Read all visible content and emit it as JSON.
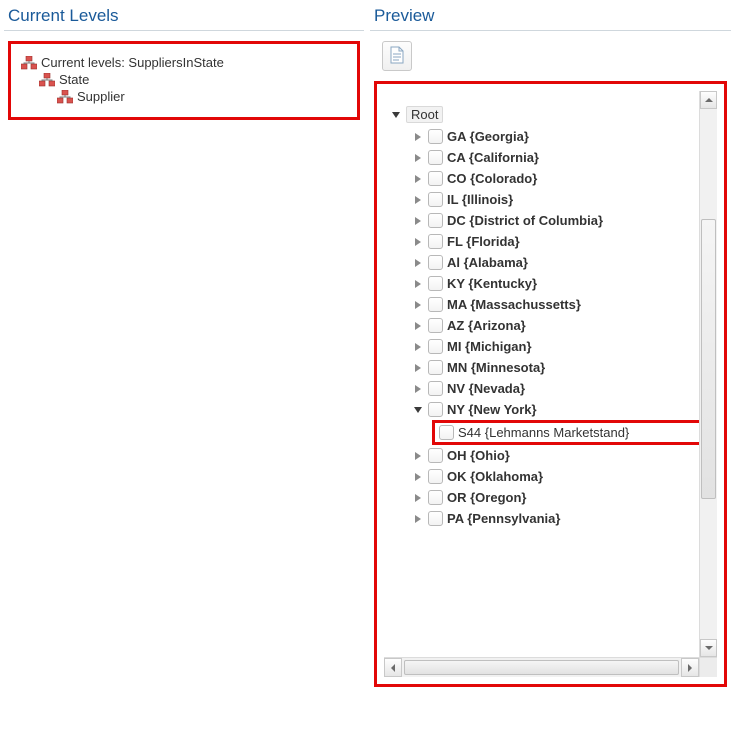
{
  "left": {
    "title": "Current Levels",
    "root_label": "Current levels: SuppliersInState",
    "children": [
      "State",
      "Supplier"
    ]
  },
  "right": {
    "title": "Preview",
    "root_label": "Root",
    "nodes": [
      {
        "label": "GA {Georgia}",
        "expanded": false,
        "highlight": false
      },
      {
        "label": "CA {California}",
        "expanded": false,
        "highlight": false
      },
      {
        "label": "CO {Colorado}",
        "expanded": false,
        "highlight": false
      },
      {
        "label": "IL {Illinois}",
        "expanded": false,
        "highlight": false
      },
      {
        "label": "DC {District of Columbia}",
        "expanded": false,
        "highlight": false
      },
      {
        "label": "FL {Florida}",
        "expanded": false,
        "highlight": false
      },
      {
        "label": "Al {Alabama}",
        "expanded": false,
        "highlight": false
      },
      {
        "label": "KY {Kentucky}",
        "expanded": false,
        "highlight": false
      },
      {
        "label": "MA {Massachussetts}",
        "expanded": false,
        "highlight": false
      },
      {
        "label": "AZ {Arizona}",
        "expanded": false,
        "highlight": false
      },
      {
        "label": "MI {Michigan}",
        "expanded": false,
        "highlight": false
      },
      {
        "label": "MN {Minnesota}",
        "expanded": false,
        "highlight": false
      },
      {
        "label": "NV {Nevada}",
        "expanded": false,
        "highlight": false
      },
      {
        "label": "NY {New York}",
        "expanded": true,
        "highlight": false,
        "children": [
          {
            "label": "S44 {Lehmanns Marketstand}",
            "highlight": true
          }
        ]
      },
      {
        "label": "OH {Ohio}",
        "expanded": false,
        "highlight": false
      },
      {
        "label": "OK {Oklahoma}",
        "expanded": false,
        "highlight": false
      },
      {
        "label": "OR {Oregon}",
        "expanded": false,
        "highlight": false
      },
      {
        "label": "PA {Pennsylvania}",
        "expanded": false,
        "highlight": false
      }
    ]
  }
}
